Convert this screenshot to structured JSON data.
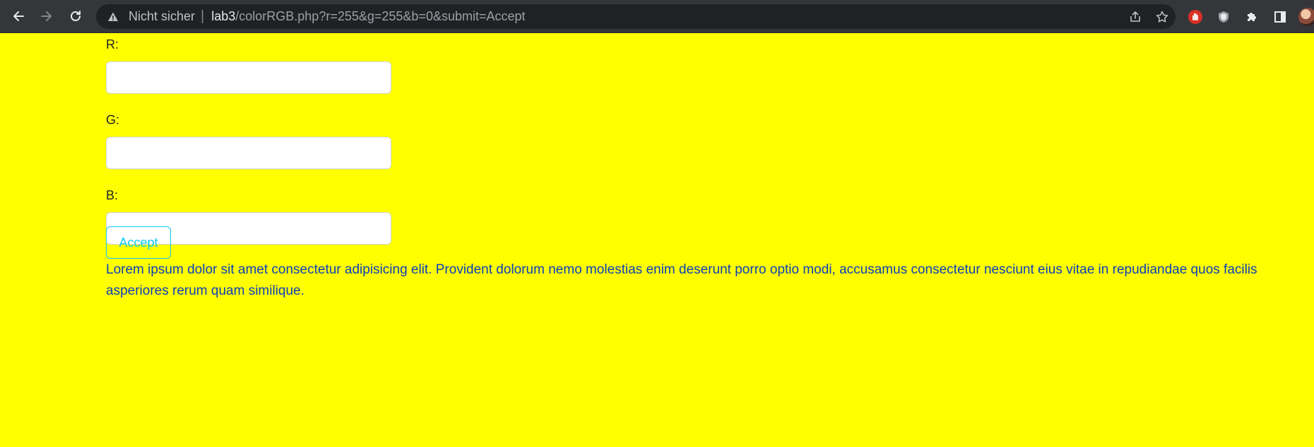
{
  "browser": {
    "security_label": "Nicht sicher",
    "url_host": "lab3",
    "url_path": "/colorRGB.php?r=255&g=255&b=0&submit=Accept"
  },
  "page": {
    "background": "#ffff00",
    "fields": [
      {
        "label": "R:",
        "value": ""
      },
      {
        "label": "G:",
        "value": ""
      },
      {
        "label": "B:",
        "value": ""
      }
    ],
    "submit_label": "Accept",
    "paragraph": "Lorem ipsum dolor sit amet consectetur adipisicing elit. Provident dolorum nemo molestias enim deserunt porro optio modi, accusamus consectetur nesciunt eius vitae in repudiandae quos facilis asperiores rerum quam similique."
  },
  "icons": [
    "back-icon",
    "forward-icon",
    "reload-icon",
    "warning-icon",
    "share-icon",
    "star-icon",
    "adblock-icon",
    "shield-extension-icon",
    "puzzle-icon",
    "side-panel-icon",
    "avatar"
  ]
}
